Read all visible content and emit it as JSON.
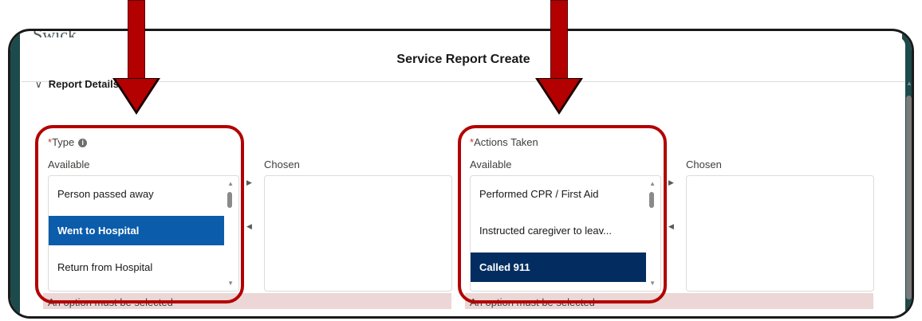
{
  "background": {
    "brand_fragment": "Swick"
  },
  "modal": {
    "title": "Service Report Create"
  },
  "section": {
    "title": "Report Details",
    "chevron": "chevron-down-icon"
  },
  "type_field": {
    "required_mark": "*",
    "label": "Type",
    "info_icon": "i",
    "available_label": "Available",
    "chosen_label": "Chosen",
    "options": [
      "Person passed away",
      "Went to Hospital",
      "Return from Hospital"
    ],
    "selected": "Went to Hospital",
    "error": "An option must be selected"
  },
  "actions_field": {
    "required_mark": "*",
    "label": "Actions Taken",
    "available_label": "Available",
    "chosen_label": "Chosen",
    "options": [
      "Performed CPR / First Aid",
      "Instructed caregiver to leav...",
      "Called 911"
    ],
    "selected": "Called 911",
    "error": "An option must be selected"
  },
  "annotations": {
    "color": "#b30000"
  },
  "colors": {
    "selected_blue": "#0b5cab",
    "selected_navy": "#032d60",
    "error_bg": "#ecd6d6",
    "required": "#c23934"
  }
}
